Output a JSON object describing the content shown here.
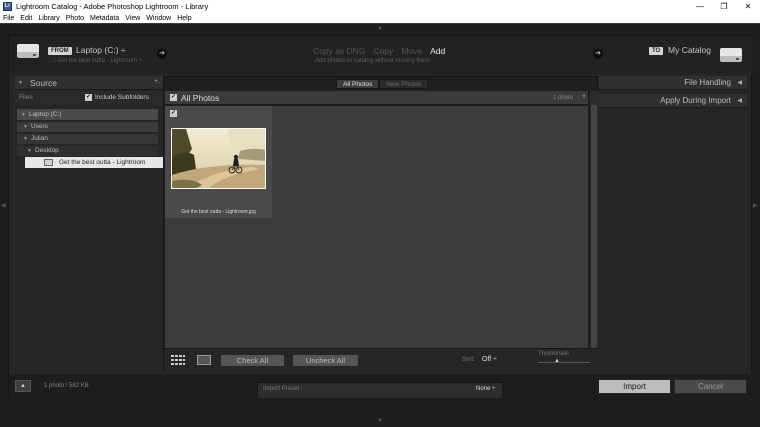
{
  "window": {
    "title": "Lightroom Catalog - Adobe Photoshop Lightroom - Library",
    "app_icon_text": "Lr",
    "controls": {
      "minimize": "—",
      "restore": "❐",
      "close": "✕"
    }
  },
  "menu": [
    "File",
    "Edit",
    "Library",
    "Photo",
    "Metadata",
    "View",
    "Window",
    "Help"
  ],
  "header": {
    "from_badge": "FROM",
    "from_label": "Laptop (C:) ÷",
    "from_path": "...\\ Get the best outta - Lightroom ÷",
    "to_badge": "TO",
    "to_label": "My Catalog",
    "modes": [
      "Copy as DNG",
      "Copy",
      "Move",
      "Add"
    ],
    "active_mode": "Add",
    "mode_description": "Add photos to catalog without moving them"
  },
  "source": {
    "title": "Source",
    "add_symbol": "+.",
    "files_label": "Files",
    "include_subfolders": "Include Subfolders",
    "include_subfolders_checked": true,
    "tree": [
      {
        "label": "Laptop (C:)",
        "level": 0
      },
      {
        "label": "Users",
        "level": 1
      },
      {
        "label": "Julian",
        "level": 2
      },
      {
        "label": "Desktop",
        "level": 3
      },
      {
        "label": "Get the best outta - Lightroom",
        "level": 4,
        "selected": true
      }
    ]
  },
  "center": {
    "tabs": [
      "All Photos",
      "New Photos"
    ],
    "active_tab": "All Photos",
    "grid_title": "All Photos",
    "photo_count": "1 photo",
    "photos": [
      {
        "filename": "Get the best outta - Lightroom.jpg",
        "checked": true
      }
    ],
    "check_all": "Check All",
    "uncheck_all": "Uncheck All",
    "sort_label": "Sort:",
    "sort_value": "Off ÷",
    "thumbnails_label": "Thumbnails"
  },
  "right": {
    "file_handling": "File Handling",
    "apply_during_import": "Apply During Import"
  },
  "footer": {
    "status": "1 photo / 582 KB",
    "preset_label": "Import Preset :",
    "preset_value": "None ÷",
    "import": "Import",
    "cancel": "Cancel"
  }
}
